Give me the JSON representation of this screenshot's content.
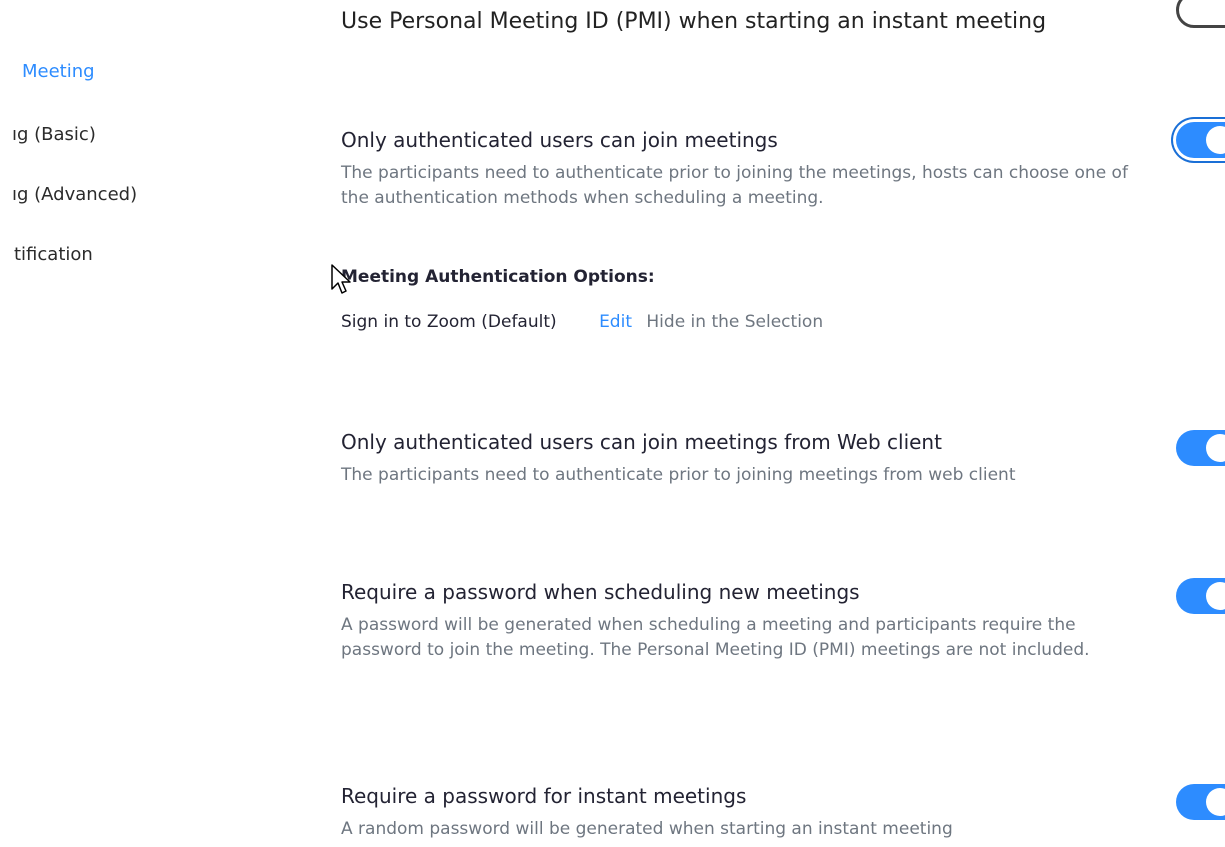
{
  "top_section": {
    "title": "Use Personal Meeting ID (PMI) when starting an instant meeting"
  },
  "sidebar": {
    "items": [
      {
        "label": "Meeting",
        "active": true
      },
      {
        "label": "ıg (Basic)",
        "active": false
      },
      {
        "label": "ıg (Advanced)",
        "active": false
      },
      {
        "label": "tification",
        "active": false
      }
    ]
  },
  "settings": [
    {
      "title": "Only authenticated users can join meetings",
      "description": "The participants need to authenticate prior to joining the meetings, hosts can choose one of the authentication methods when scheduling a meeting.",
      "enabled": true
    },
    {
      "title": "Only authenticated users can join meetings from Web client",
      "description": "The participants need to authenticate prior to joining meetings from web client",
      "enabled": true
    },
    {
      "title": "Require a password when scheduling new meetings",
      "description": "A password will be generated when scheduling a meeting and participants require the password to join the meeting. The Personal Meeting ID (PMI) meetings are not included.",
      "enabled": true
    },
    {
      "title": "Require a password for instant meetings",
      "description": "A random password will be generated when starting an instant meeting",
      "enabled": true
    }
  ],
  "auth_options": {
    "heading": "Meeting Authentication Options:",
    "option_label": "Sign in to Zoom (Default)",
    "edit_label": "Edit",
    "hide_label": "Hide in the Selection"
  },
  "colors": {
    "accent": "#2d8cff",
    "title_text": "#232333",
    "desc_text": "#6e7680"
  }
}
